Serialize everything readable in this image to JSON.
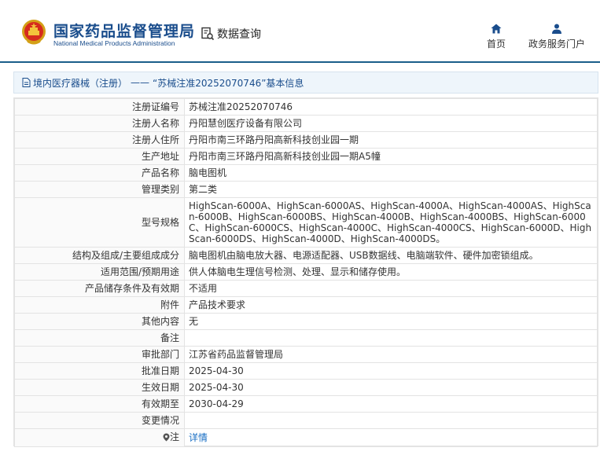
{
  "header": {
    "site_name": "国家药品监督管理局",
    "site_name_en": "National Medical Products Administration",
    "query_label": "数据查询",
    "nav": [
      {
        "label": "首页",
        "icon": "home-icon"
      },
      {
        "label": "政务服务门户",
        "icon": "user-icon"
      }
    ]
  },
  "breadcrumb": {
    "category": "境内医疗器械（注册）",
    "separator": "——",
    "title": "“苏械注准20252070746”基本信息"
  },
  "details": [
    {
      "label": "注册证编号",
      "value": "苏械注准20252070746"
    },
    {
      "label": "注册人名称",
      "value": "丹阳慧创医疗设备有限公司"
    },
    {
      "label": "注册人住所",
      "value": "丹阳市南三环路丹阳高新科技创业园一期"
    },
    {
      "label": "生产地址",
      "value": "丹阳市南三环路丹阳高新科技创业园一期A5幢"
    },
    {
      "label": "产品名称",
      "value": "脑电图机"
    },
    {
      "label": "管理类别",
      "value": "第二类"
    },
    {
      "label": "型号规格",
      "value": "HighScan-6000A、HighScan-6000AS、HighScan-4000A、HighScan-4000AS、HighScan-6000B、HighScan-6000BS、HighScan-4000B、HighScan-4000BS、HighScan-6000C、HighScan-6000CS、HighScan-4000C、HighScan-4000CS、HighScan-6000D、HighScan-6000DS、HighScan-4000D、HighScan-4000DS。"
    },
    {
      "label": "结构及组成/主要组成成分",
      "value": "脑电图机由脑电放大器、电源适配器、USB数据线、电脑端软件、硬件加密锁组成。"
    },
    {
      "label": "适用范围/预期用途",
      "value": "供人体脑电生理信号检测、处理、显示和储存使用。"
    },
    {
      "label": "产品储存条件及有效期",
      "value": "不适用"
    },
    {
      "label": "附件",
      "value": "产品技术要求"
    },
    {
      "label": "其他内容",
      "value": "无"
    },
    {
      "label": "备注",
      "value": ""
    },
    {
      "label": "审批部门",
      "value": "江苏省药品监督管理局"
    },
    {
      "label": "批准日期",
      "value": "2025-04-30"
    },
    {
      "label": "生效日期",
      "value": "2025-04-30"
    },
    {
      "label": "有效期至",
      "value": "2030-04-29"
    },
    {
      "label": "变更情况",
      "value": ""
    }
  ],
  "note": {
    "label": "注",
    "icon": "info-icon",
    "link_text": "详情"
  }
}
